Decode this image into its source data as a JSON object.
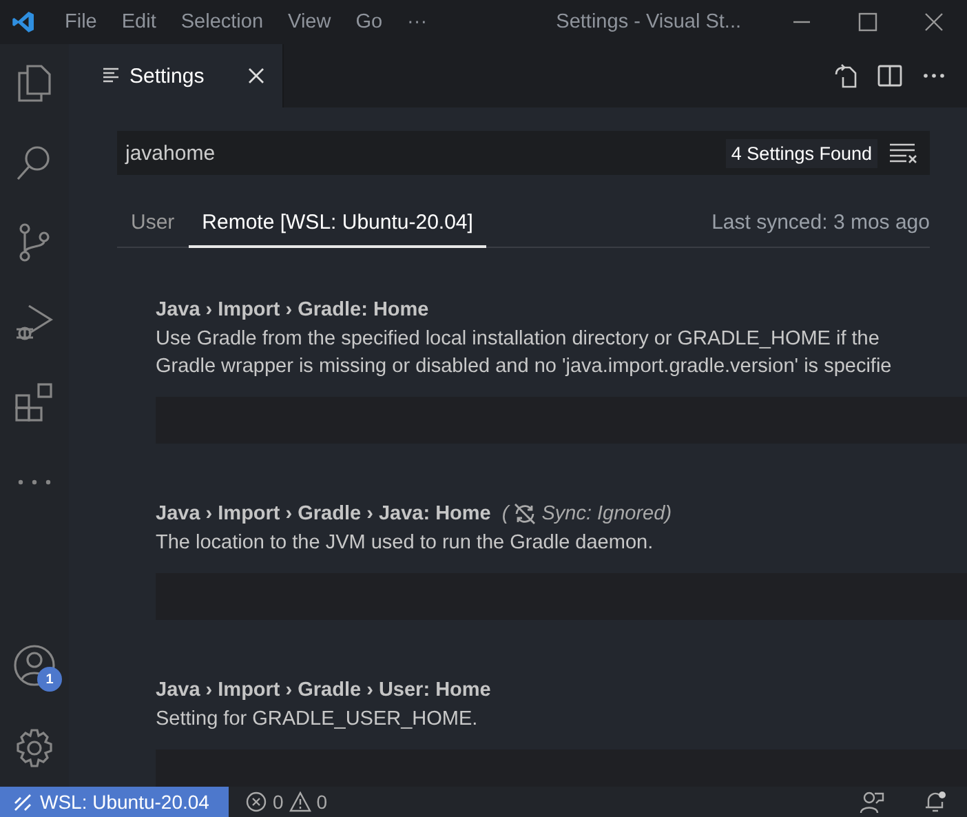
{
  "window": {
    "title": "Settings - Visual St..."
  },
  "menu": [
    "File",
    "Edit",
    "Selection",
    "View",
    "Go",
    "···"
  ],
  "activity_bar": {
    "account_badge": "1"
  },
  "editor_tabs": [
    {
      "label": "Settings",
      "selected": true
    }
  ],
  "search": {
    "value": "javahome",
    "result_count": "4 Settings Found"
  },
  "scope_tabs": [
    {
      "label": "User",
      "selected": false
    },
    {
      "label": "Remote [WSL: Ubuntu-20.04]",
      "selected": true
    }
  ],
  "sync_status": "Last synced: 3 mos ago",
  "settings": [
    {
      "title": "Java › Import › Gradle: **Home**",
      "description": [
        "Use Gradle from the specified local installation directory or GRADLE_HOME if the",
        "Gradle wrapper is missing or disabled and no 'java.import.gradle.version' is specifie"
      ]
    },
    {
      "title": "Java › Import › Gradle › Java: **Home**",
      "sync_note": {
        "open": "(",
        "text": "Sync: Ignored)"
      },
      "description": [
        "The location to the JVM used to run the Gradle daemon."
      ]
    },
    {
      "title": "Java › Import › Gradle › User: **Home**",
      "description": [
        "Setting for GRADLE_USER_HOME."
      ]
    }
  ],
  "status_bar": {
    "remote": "WSL: Ubuntu-20.04",
    "errors": "0",
    "warnings": "0"
  }
}
